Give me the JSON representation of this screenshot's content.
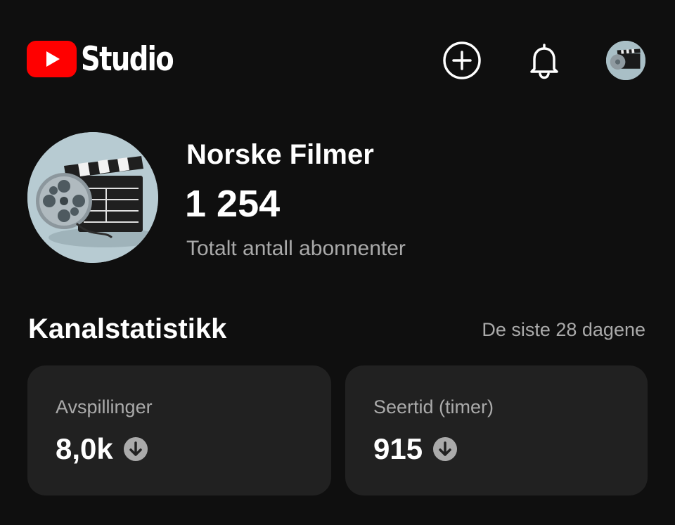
{
  "header": {
    "logo_text": "Studio",
    "brand_color": "#ff0000",
    "actions": [
      {
        "name": "create",
        "icon": "plus-circle-icon"
      },
      {
        "name": "notifications",
        "icon": "bell-icon"
      },
      {
        "name": "account",
        "icon": "channel-avatar"
      }
    ]
  },
  "channel": {
    "name": "Norske Filmer",
    "subscriber_count": "1 254",
    "subscriber_label": "Totalt antall abonnenter",
    "avatar_icon": "film-clapperboard-and-reel"
  },
  "stats": {
    "title": "Kanalstatistikk",
    "period": "De siste 28 dagene",
    "cards": [
      {
        "label": "Avspillinger",
        "value": "8,0k",
        "trend_icon": "arrow-down-circle-icon"
      },
      {
        "label": "Seertid (timer)",
        "value": "915",
        "trend_icon": "arrow-down-circle-icon"
      }
    ]
  },
  "colors": {
    "background": "#0f0f0f",
    "card": "#212121",
    "text_secondary": "#aaaaaa"
  }
}
